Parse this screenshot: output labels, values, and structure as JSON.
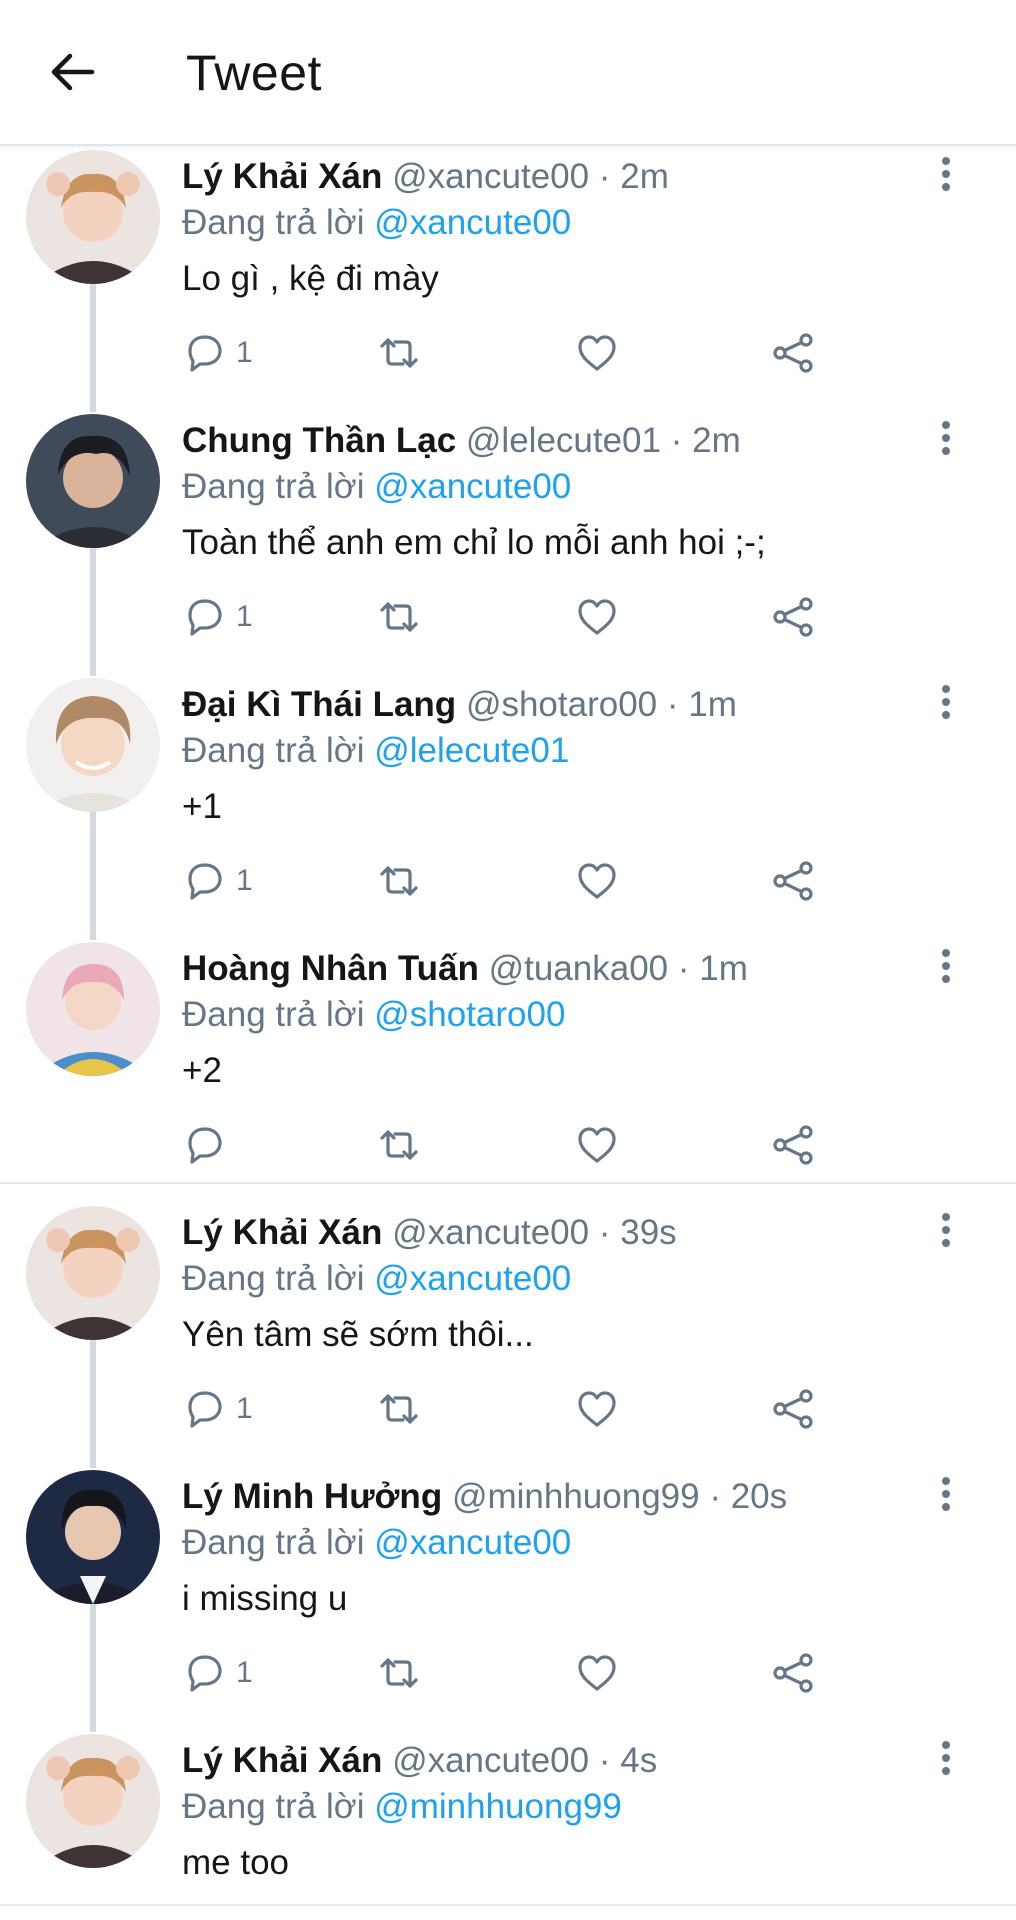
{
  "header": {
    "title": "Tweet",
    "back_icon": "arrow-left-icon"
  },
  "colors": {
    "link": "#1da1f2",
    "muted": "#657786",
    "text": "#14171a",
    "line": "#d4dadf"
  },
  "tweets": [
    {
      "name": "Lý Khải Xán",
      "handle": "@xancute00",
      "time": "· 2m",
      "replying_label": "Đang trả lời",
      "mention": "@xancute00",
      "text": "Lo gì , kệ đi mày",
      "reply_count": "1"
    },
    {
      "name": "Chung Thần Lạc",
      "handle": "@lelecute01",
      "time": "· 2m",
      "replying_label": "Đang trả lời",
      "mention": "@xancute00",
      "text": "Toàn thể anh em chỉ lo mỗi anh hoi ;-;",
      "reply_count": "1"
    },
    {
      "name": "Đại Kì Thái Lang",
      "handle": "@shotaro00",
      "time": "· 1m",
      "replying_label": "Đang trả lời",
      "mention": "@lelecute01",
      "text": "+1",
      "reply_count": "1"
    },
    {
      "name": "Hoàng Nhân Tuấn",
      "handle": "@tuanka00",
      "time": "· 1m",
      "replying_label": "Đang trả lời",
      "mention": "@shotaro00",
      "text": "+2",
      "reply_count": ""
    },
    {
      "name": "Lý Khải Xán",
      "handle": "@xancute00",
      "time": "· 39s",
      "replying_label": "Đang trả lời",
      "mention": "@xancute00",
      "text": "Yên tâm sẽ sớm thôi...",
      "reply_count": "1"
    },
    {
      "name": "Lý Minh Hưởng",
      "handle": "@minhhuong99",
      "time": "· 20s",
      "replying_label": "Đang trả lời",
      "mention": "@xancute00",
      "text": "i missing u",
      "reply_count": "1"
    },
    {
      "name": "Lý Khải Xán",
      "handle": "@xancute00",
      "time": "· 4s",
      "replying_label": "Đang trả lời",
      "mention": "@minhhuong99",
      "text": "me too",
      "reply_count": ""
    }
  ]
}
